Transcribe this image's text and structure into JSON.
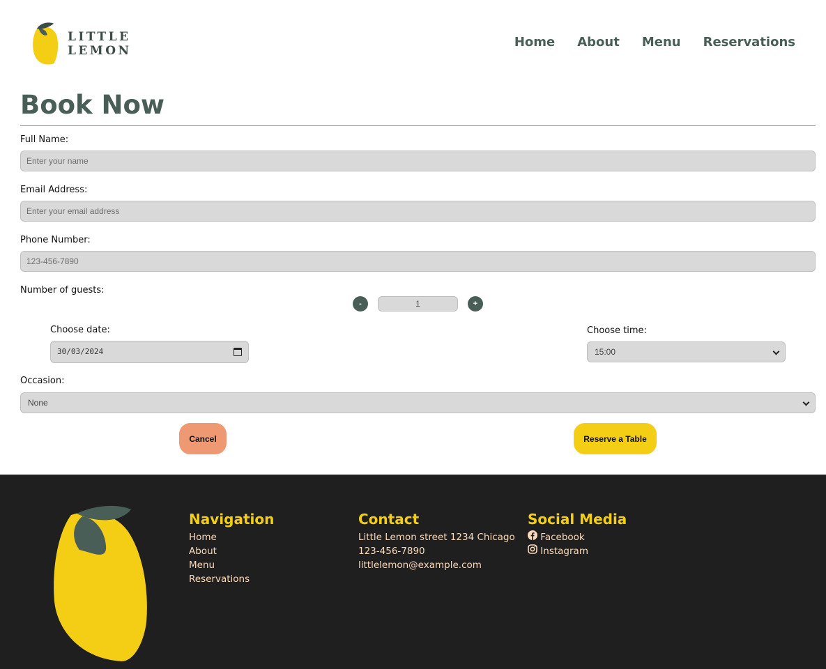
{
  "brand": {
    "name": "LITTLE LEMON"
  },
  "nav": {
    "items": [
      "Home",
      "About",
      "Menu",
      "Reservations"
    ]
  },
  "form": {
    "title": "Book Now",
    "full_name": {
      "label": "Full Name:",
      "placeholder": "Enter your name"
    },
    "email": {
      "label": "Email Address:",
      "placeholder": "Enter your email address"
    },
    "phone": {
      "label": "Phone Number:",
      "placeholder": "123-456-7890"
    },
    "guests": {
      "label": "Number of guests:",
      "value": "1",
      "minus": "-",
      "plus": "+"
    },
    "date": {
      "label": "Choose date:",
      "value": "30/03/2024"
    },
    "time": {
      "label": "Choose time:",
      "value": "15:00"
    },
    "occasion": {
      "label": "Occasion:",
      "value": "None"
    },
    "cancel_label": "Cancel",
    "reserve_label": "Reserve a Table"
  },
  "footer": {
    "navigation": {
      "heading": "Navigation",
      "items": [
        "Home",
        "About",
        "Menu",
        "Reservations"
      ]
    },
    "contact": {
      "heading": "Contact",
      "address": "Little Lemon street 1234 Chicago",
      "phone": "123-456-7890",
      "email": "littlelemon@example.com"
    },
    "social": {
      "heading": "Social Media",
      "facebook": "Facebook",
      "instagram": "Instagram"
    }
  },
  "colors": {
    "primary_green": "#495e57",
    "yellow": "#f4ce14",
    "salmon": "#ee9972",
    "footer_bg": "#1f1f1f",
    "footer_text": "#fbdabb",
    "field_bg": "#d9d9d9"
  },
  "icons": [
    "lemon-logo-icon",
    "calendar-icon",
    "chevron-down-icon",
    "facebook-icon",
    "instagram-icon",
    "footer-lemon-icon"
  ]
}
